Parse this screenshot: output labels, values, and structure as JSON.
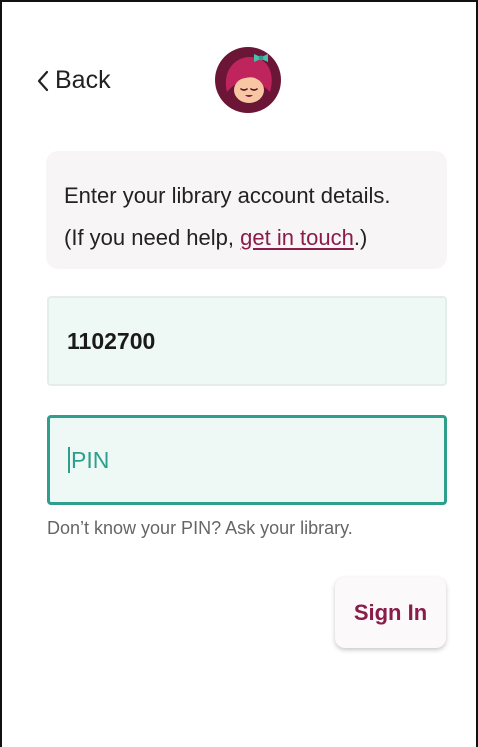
{
  "header": {
    "back_label": "Back",
    "logo_icon": "libby-logo-icon"
  },
  "info": {
    "line1": "Enter your library account details.",
    "line2_prefix": "(If you need help, ",
    "link_text": "get in touch",
    "line2_suffix": ".)"
  },
  "form": {
    "card_number_value": "1102700",
    "pin_placeholder": "PIN",
    "pin_hint": "Don’t know your PIN? Ask your library."
  },
  "actions": {
    "sign_in_label": "Sign In"
  },
  "colors": {
    "brand": "#8a1c4a",
    "accent": "#2e9f8d",
    "field_bg": "#eef8f5",
    "card_bg": "#f7f5f6"
  }
}
